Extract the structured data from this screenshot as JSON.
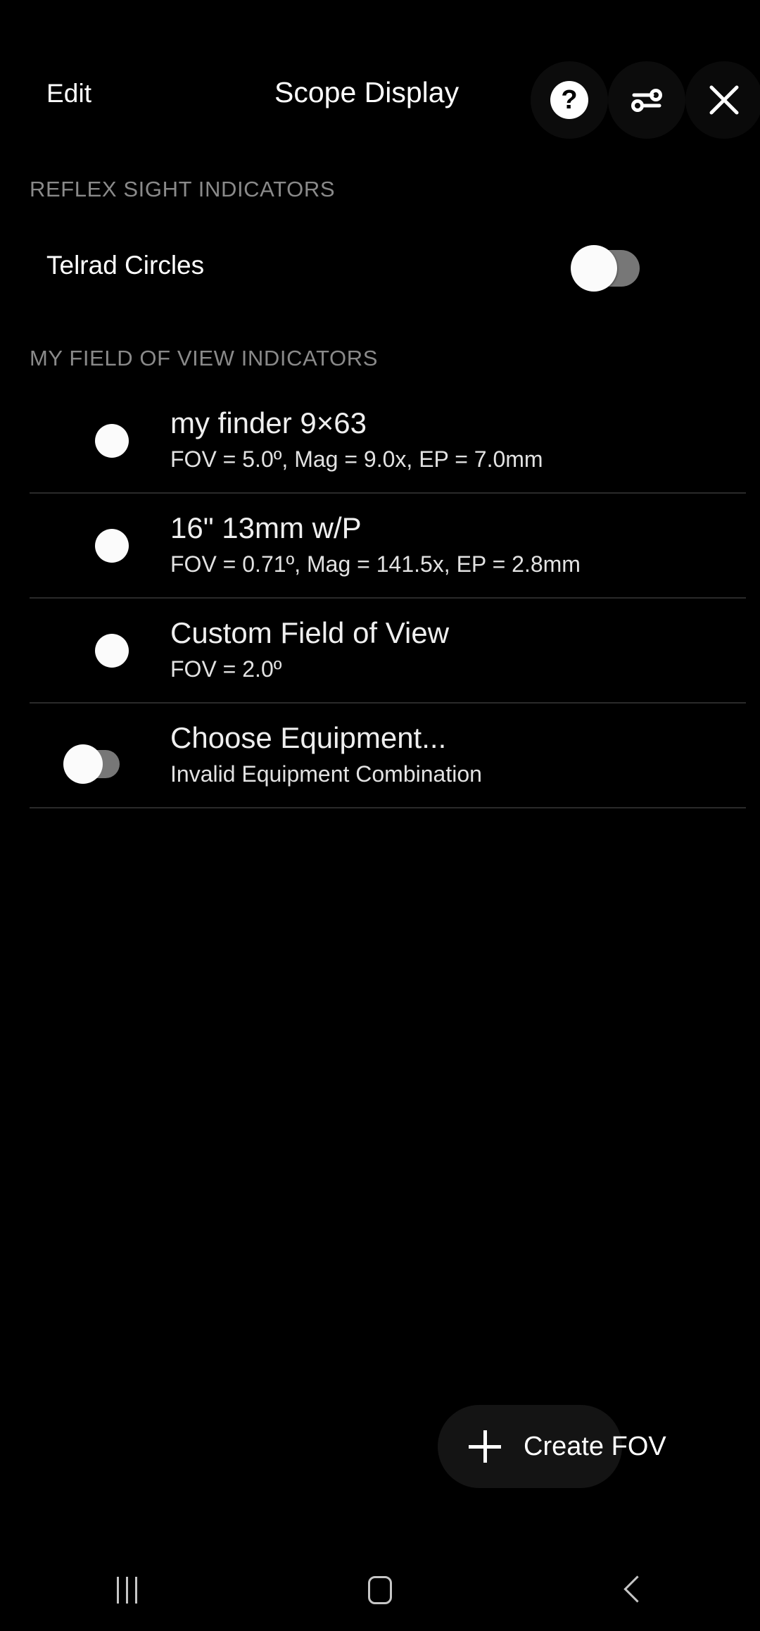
{
  "header": {
    "edit_label": "Edit",
    "title": "Scope Display",
    "actions": [
      {
        "name": "help-icon",
        "glyph": "?"
      },
      {
        "name": "sliders-icon",
        "glyph": ""
      },
      {
        "name": "close-icon",
        "glyph": ""
      }
    ]
  },
  "sections": {
    "reflex": {
      "header": "REFLEX SIGHT INDICATORS",
      "telrad": {
        "label": "Telrad Circles",
        "toggle_state": "off"
      }
    },
    "fov": {
      "header": "MY FIELD OF VIEW INDICATORS",
      "rows": [
        {
          "control": "radio",
          "selected": false,
          "title": "my finder 9×63",
          "subtitle": "FOV = 5.0º, Mag = 9.0x, EP = 7.0mm"
        },
        {
          "control": "radio",
          "selected": false,
          "title": "16\" 13mm w/P",
          "subtitle": "FOV = 0.71º, Mag = 141.5x, EP = 2.8mm"
        },
        {
          "control": "radio",
          "selected": false,
          "title": "Custom Field of View",
          "subtitle": "FOV = 2.0º"
        },
        {
          "control": "switch",
          "toggle_state": "off",
          "title": "Choose Equipment...",
          "subtitle": "Invalid Equipment Combination"
        }
      ]
    }
  },
  "create_fov": {
    "label": "Create FOV",
    "icon": "plus-icon"
  },
  "navbar": {
    "recents_label": "recents-icon",
    "home_label": "home-icon",
    "back_label": "back-icon"
  },
  "colors": {
    "background": "#000000",
    "section_header": "#8a8a8a",
    "primary_text": "#ffffff",
    "divider": "#2a2a2a",
    "switch_track_off": "#777777",
    "switch_knob": "#fbfbfb",
    "fab_background": "#141414",
    "navbar_icon": "#c6c6c6"
  }
}
